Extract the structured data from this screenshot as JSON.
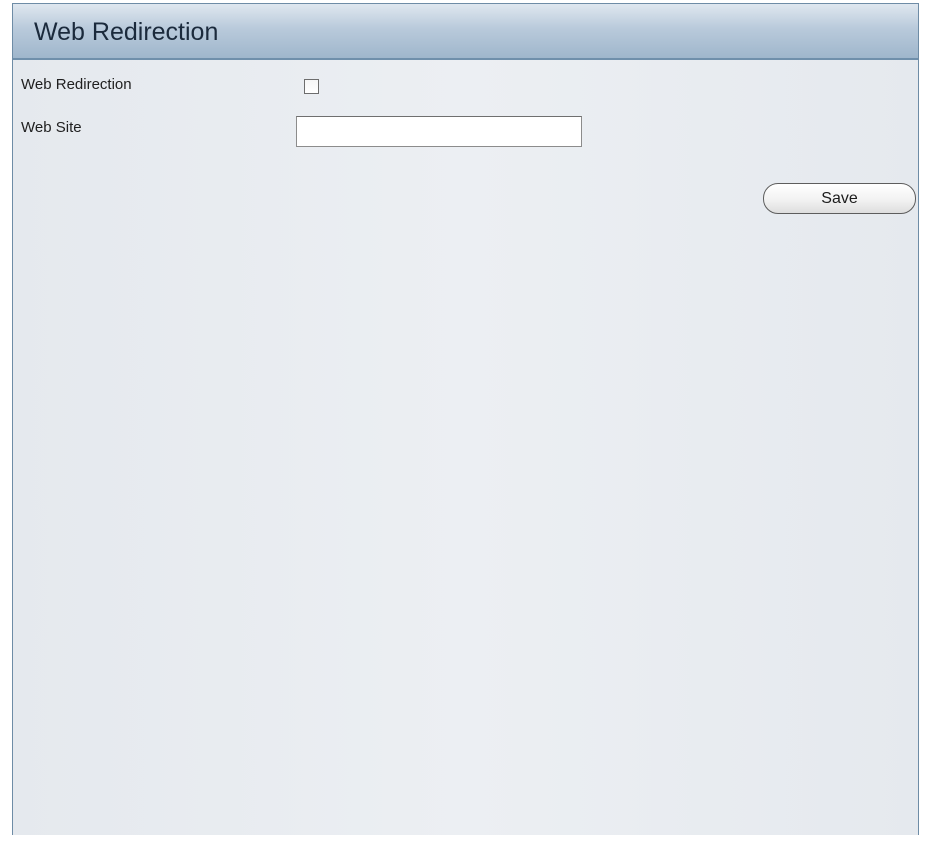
{
  "panel": {
    "title": "Web Redirection"
  },
  "form": {
    "web_redirection": {
      "label": "Web Redirection",
      "checked": false
    },
    "web_site": {
      "label": "Web Site",
      "value": ""
    }
  },
  "actions": {
    "save_label": "Save"
  }
}
